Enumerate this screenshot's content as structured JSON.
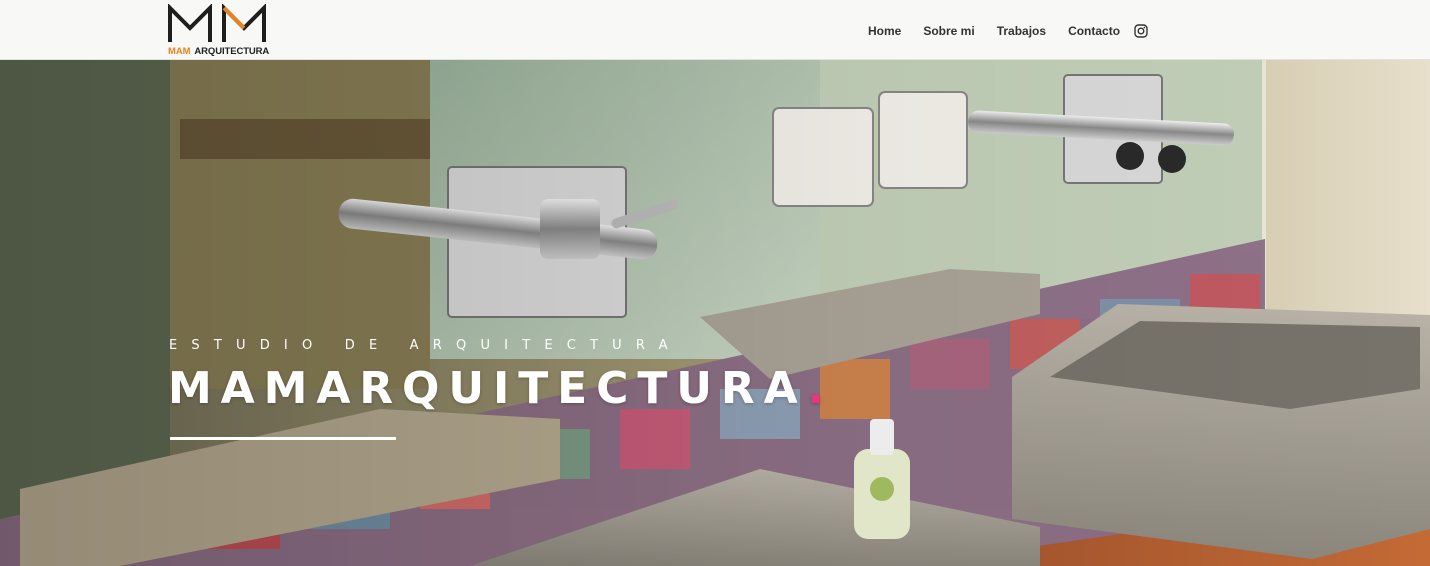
{
  "logo": {
    "mark": "MM",
    "text_accent": "MAM",
    "text_main": "ARQUITECTURA",
    "accent_color": "#e8841f"
  },
  "nav": {
    "items": [
      "Home",
      "Sobre mi",
      "Trabajos",
      "Contacto"
    ],
    "social_icon": "instagram-icon"
  },
  "hero": {
    "kicker": "ESTUDIO DE ARQUITECTURA",
    "title": "MAMARQUITECTURA",
    "title_dot": ".",
    "dot_color": "#e8387a",
    "image_description": "bathroom-sinks-photo"
  }
}
